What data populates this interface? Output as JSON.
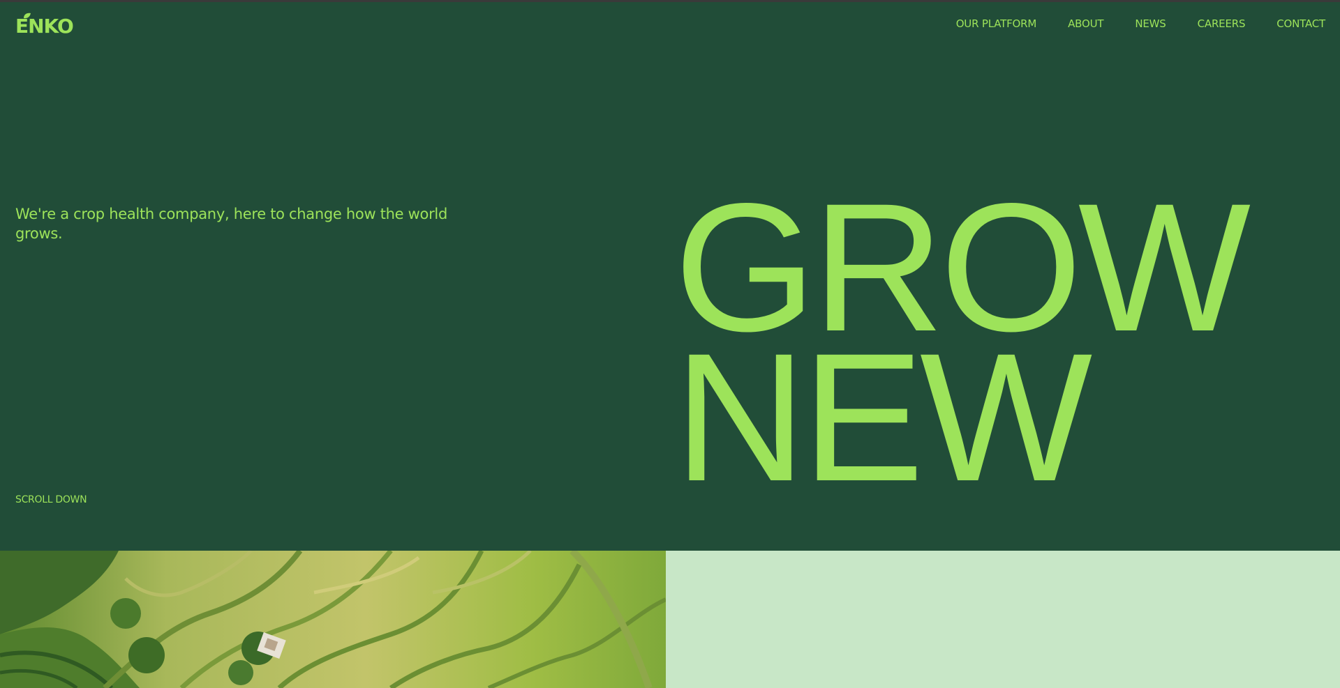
{
  "brand": {
    "name": "ENKO",
    "accent": "#9de35a",
    "background": "#214d38",
    "mint": "#c8e7c7"
  },
  "nav": {
    "items": [
      {
        "label": "OUR PLATFORM"
      },
      {
        "label": "ABOUT"
      },
      {
        "label": "NEWS"
      },
      {
        "label": "CAREERS"
      },
      {
        "label": "CONTACT"
      }
    ]
  },
  "hero": {
    "tagline": "We're a crop health company, here to change how the world grows.",
    "headline_line1": "GROW",
    "headline_line2": "NEW",
    "scroll_label": "SCROLL DOWN"
  },
  "media": {
    "photo_subject": "aerial-rice-terraces"
  }
}
